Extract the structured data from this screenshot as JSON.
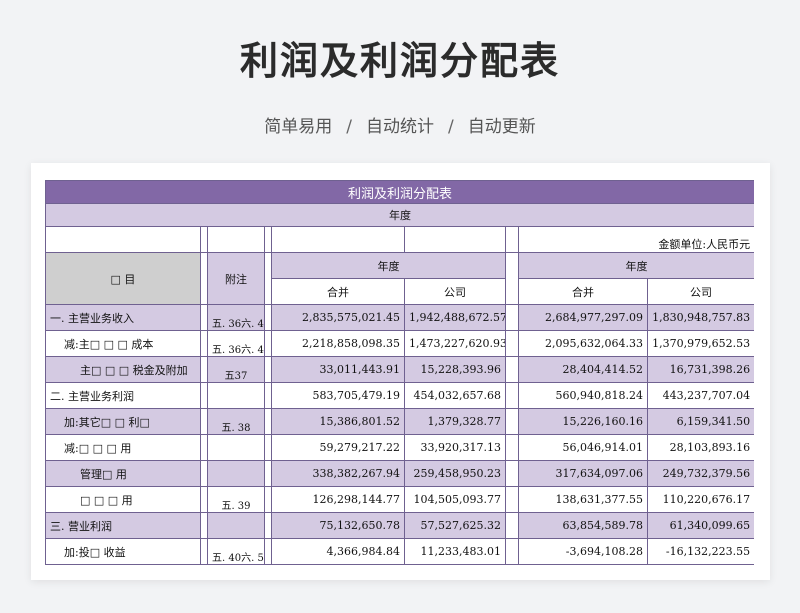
{
  "header": {
    "title": "利润及利润分配表",
    "subtitle_items": [
      "简单易用",
      "自动统计",
      "自动更新"
    ],
    "separator": "/"
  },
  "sheet": {
    "banner": "利润及利润分配表",
    "year_row": "年度",
    "unit_note": "金额单位:人民币元",
    "col_item": "□    目",
    "col_note": "附注",
    "group1": "年度",
    "group2": "年度",
    "sub_merge1": "合并",
    "sub_company1": "公司",
    "sub_merge2": "合并",
    "sub_company2": "公司",
    "rows": [
      {
        "item": "一. 主营业务收入",
        "note": "五. 36六. 4",
        "c1": "2,835,575,021.45",
        "c2": "1,942,488,672.57",
        "c3": "2,684,977,297.09",
        "c4": "1,830,948,757.83"
      },
      {
        "item": "减:主□ □ □ 成本",
        "note": "五. 36六. 4",
        "c1": "2,218,858,098.35",
        "c2": "1,473,227,620.93",
        "c3": "2,095,632,064.33",
        "c4": "1,370,979,652.53"
      },
      {
        "item": "主□ □ □ 税金及附加",
        "note": "五37",
        "c1": "33,011,443.91",
        "c2": "15,228,393.96",
        "c3": "28,404,414.52",
        "c4": "16,731,398.26"
      },
      {
        "item": "二. 主营业务利润",
        "note": "",
        "c1": "583,705,479.19",
        "c2": "454,032,657.68",
        "c3": "560,940,818.24",
        "c4": "443,237,707.04"
      },
      {
        "item": "加:其它□ □ 利□",
        "note": "五. 38",
        "c1": "15,386,801.52",
        "c2": "1,379,328.77",
        "c3": "15,226,160.16",
        "c4": "6,159,341.50"
      },
      {
        "item": "减:□ □ □ 用",
        "note": "",
        "c1": "59,279,217.22",
        "c2": "33,920,317.13",
        "c3": "56,046,914.01",
        "c4": "28,103,893.16"
      },
      {
        "item": "管理□ 用",
        "note": "",
        "c1": "338,382,267.94",
        "c2": "259,458,950.23",
        "c3": "317,634,097.06",
        "c4": "249,732,379.56"
      },
      {
        "item": "□ □ □ 用",
        "note": "五. 39",
        "c1": "126,298,144.77",
        "c2": "104,505,093.77",
        "c3": "138,631,377.55",
        "c4": "110,220,676.17"
      },
      {
        "item": "三. 营业利润",
        "note": "",
        "c1": "75,132,650.78",
        "c2": "57,527,625.32",
        "c3": "63,854,589.78",
        "c4": "61,340,099.65"
      },
      {
        "item": "加:投□ 收益",
        "note": "五. 40六. 5",
        "c1": "4,366,984.84",
        "c2": "11,233,483.01",
        "c3": "-3,694,108.28",
        "c4": "-16,132,223.55"
      }
    ]
  },
  "colors": {
    "banner": "#8268a6",
    "lavender": "#d4cae2",
    "border": "#6f6190",
    "gray_cell": "#cfcfcf"
  }
}
